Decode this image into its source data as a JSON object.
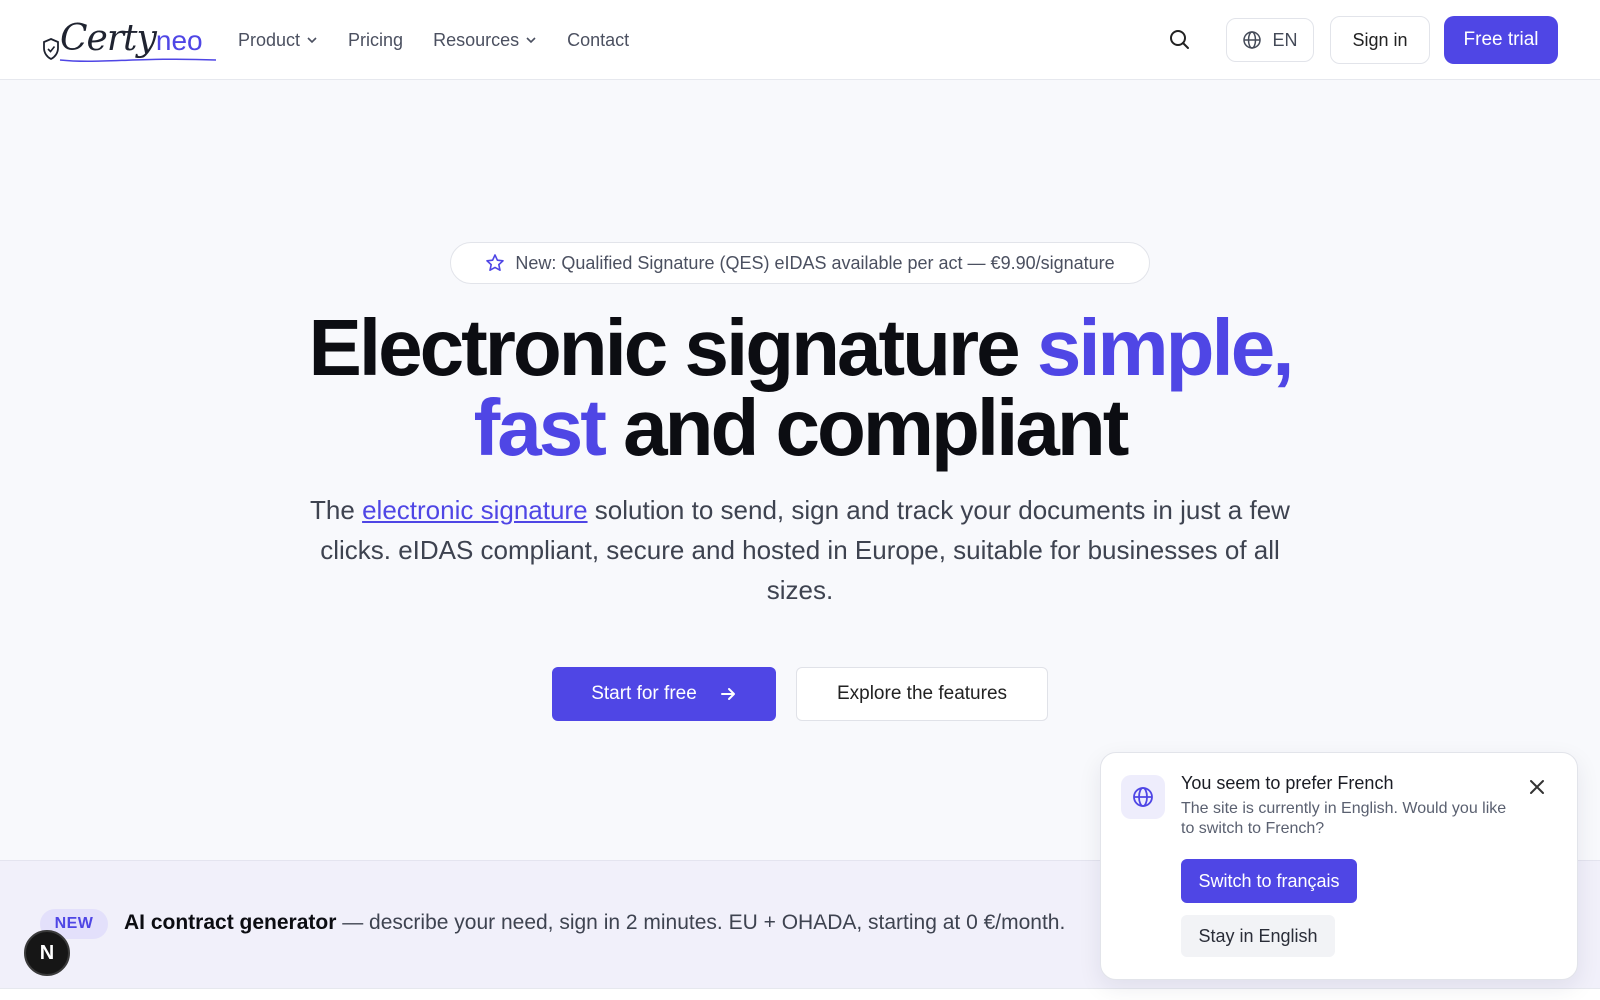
{
  "header": {
    "logo": {
      "text_main": "Certy",
      "text_accent": "neo"
    },
    "nav": [
      {
        "label": "Product",
        "has_dropdown": true
      },
      {
        "label": "Pricing",
        "has_dropdown": false
      },
      {
        "label": "Resources",
        "has_dropdown": true
      },
      {
        "label": "Contact",
        "has_dropdown": false
      }
    ],
    "language": "EN",
    "sign_in_label": "Sign in",
    "free_trial_label": "Free trial"
  },
  "hero": {
    "announcement": "New: Qualified Signature (QES) eIDAS available per act — €9.90/signature",
    "headline": {
      "part1": "Electronic signature ",
      "accent1": "simple,",
      "accent2": "fast",
      "part2": " and compliant"
    },
    "subtext": {
      "before": "The ",
      "link": "electronic signature",
      "after": " solution to send, sign and track your documents in just a few clicks. eIDAS compliant, secure and hosted in Europe, suitable for businesses of all sizes."
    },
    "primary_cta": "Start for free",
    "secondary_cta": "Explore the features"
  },
  "strip": {
    "badge": "NEW",
    "title": "AI contract generator",
    "text": " — describe your need, sign in 2 minutes. EU + OHADA, starting at 0 €/month."
  },
  "lang_popup": {
    "title": "You seem to prefer French",
    "message": "The site is currently in English. Would you like to switch to French?",
    "switch_label": "Switch to français",
    "stay_label": "Stay in English"
  },
  "dev_badge": "N",
  "colors": {
    "accent": "#4f46e5",
    "text": "#0c0d12",
    "muted": "#4b5060"
  }
}
